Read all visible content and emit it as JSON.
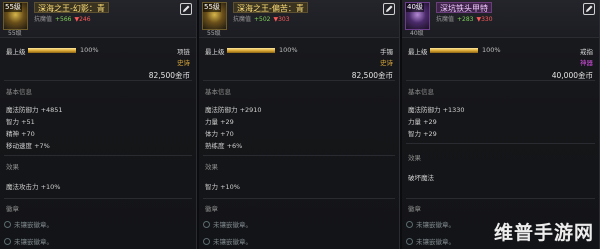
{
  "colors": {
    "gold_name": "#ffe07a",
    "purple_name": "#f0c8ff",
    "stat_up": "#7fd05a",
    "stat_down": "#ff5a5a",
    "tier_epic": "#d7a53a",
    "tier_legendary": "#d24de0",
    "bar_fill": "#d9a531"
  },
  "panels": [
    {
      "icon_tag": "55级",
      "name": "深海之王-幻影：青",
      "compare_label": "抗魔值",
      "compare_up": "+566",
      "compare_down": "▼246",
      "level": "55级",
      "level_label": "最上级",
      "bar_percent": "100%",
      "bar_fill_fraction": 1.0,
      "slot": "项链",
      "tier": "史诗",
      "tier_color": "#d7a53a",
      "price": "82,500金币",
      "basic_title": "基本信息",
      "stats": [
        "魔法防御力 +4851",
        "智力 +51",
        "精神 +70",
        "移动速度 +7%"
      ],
      "effect_title": "效果",
      "effects": [
        "魔法攻击力 +10%"
      ],
      "socket_title": "徽章",
      "sockets": [
        "未镶嵌徽章。",
        "未镶嵌徽章。"
      ]
    },
    {
      "icon_tag": "55级",
      "name": "深海之王-偏苦：青",
      "compare_label": "抗魔值",
      "compare_up": "+502",
      "compare_down": "▼303",
      "level": "55级",
      "level_label": "最上级",
      "bar_percent": "100%",
      "bar_fill_fraction": 1.0,
      "slot": "手镯",
      "tier": "史诗",
      "tier_color": "#d7a53a",
      "price": "82,500金币",
      "basic_title": "基本信息",
      "stats": [
        "魔法防御力 +2910",
        "力量 +29",
        "体力 +70",
        "熟练度 +6%"
      ],
      "effect_title": "效果",
      "effects": [
        "智力 +10%"
      ],
      "socket_title": "徽章",
      "sockets": [
        "未镶嵌徽章。",
        "未镶嵌徽章。"
      ]
    },
    {
      "icon_tag": "40级",
      "name": "深坑铁头甲特",
      "compare_label": "抗魔值",
      "compare_up": "+283",
      "compare_down": "▼330",
      "level": "40级",
      "level_label": "最上级",
      "bar_percent": "100%",
      "bar_fill_fraction": 1.0,
      "slot": "戒指",
      "tier": "神器",
      "tier_color": "#d24de0",
      "price": "40,000金币",
      "basic_title": "基本信息",
      "stats": [
        "魔法防御力 +1330",
        "力量 +29",
        "智力 +29"
      ],
      "effect_title": "效果",
      "effects": [
        "破坏魔法"
      ],
      "socket_title": "徽章",
      "sockets": [
        "未镶嵌徽章。",
        "未镶嵌徽章。"
      ]
    }
  ],
  "watermark": "维普手游网"
}
